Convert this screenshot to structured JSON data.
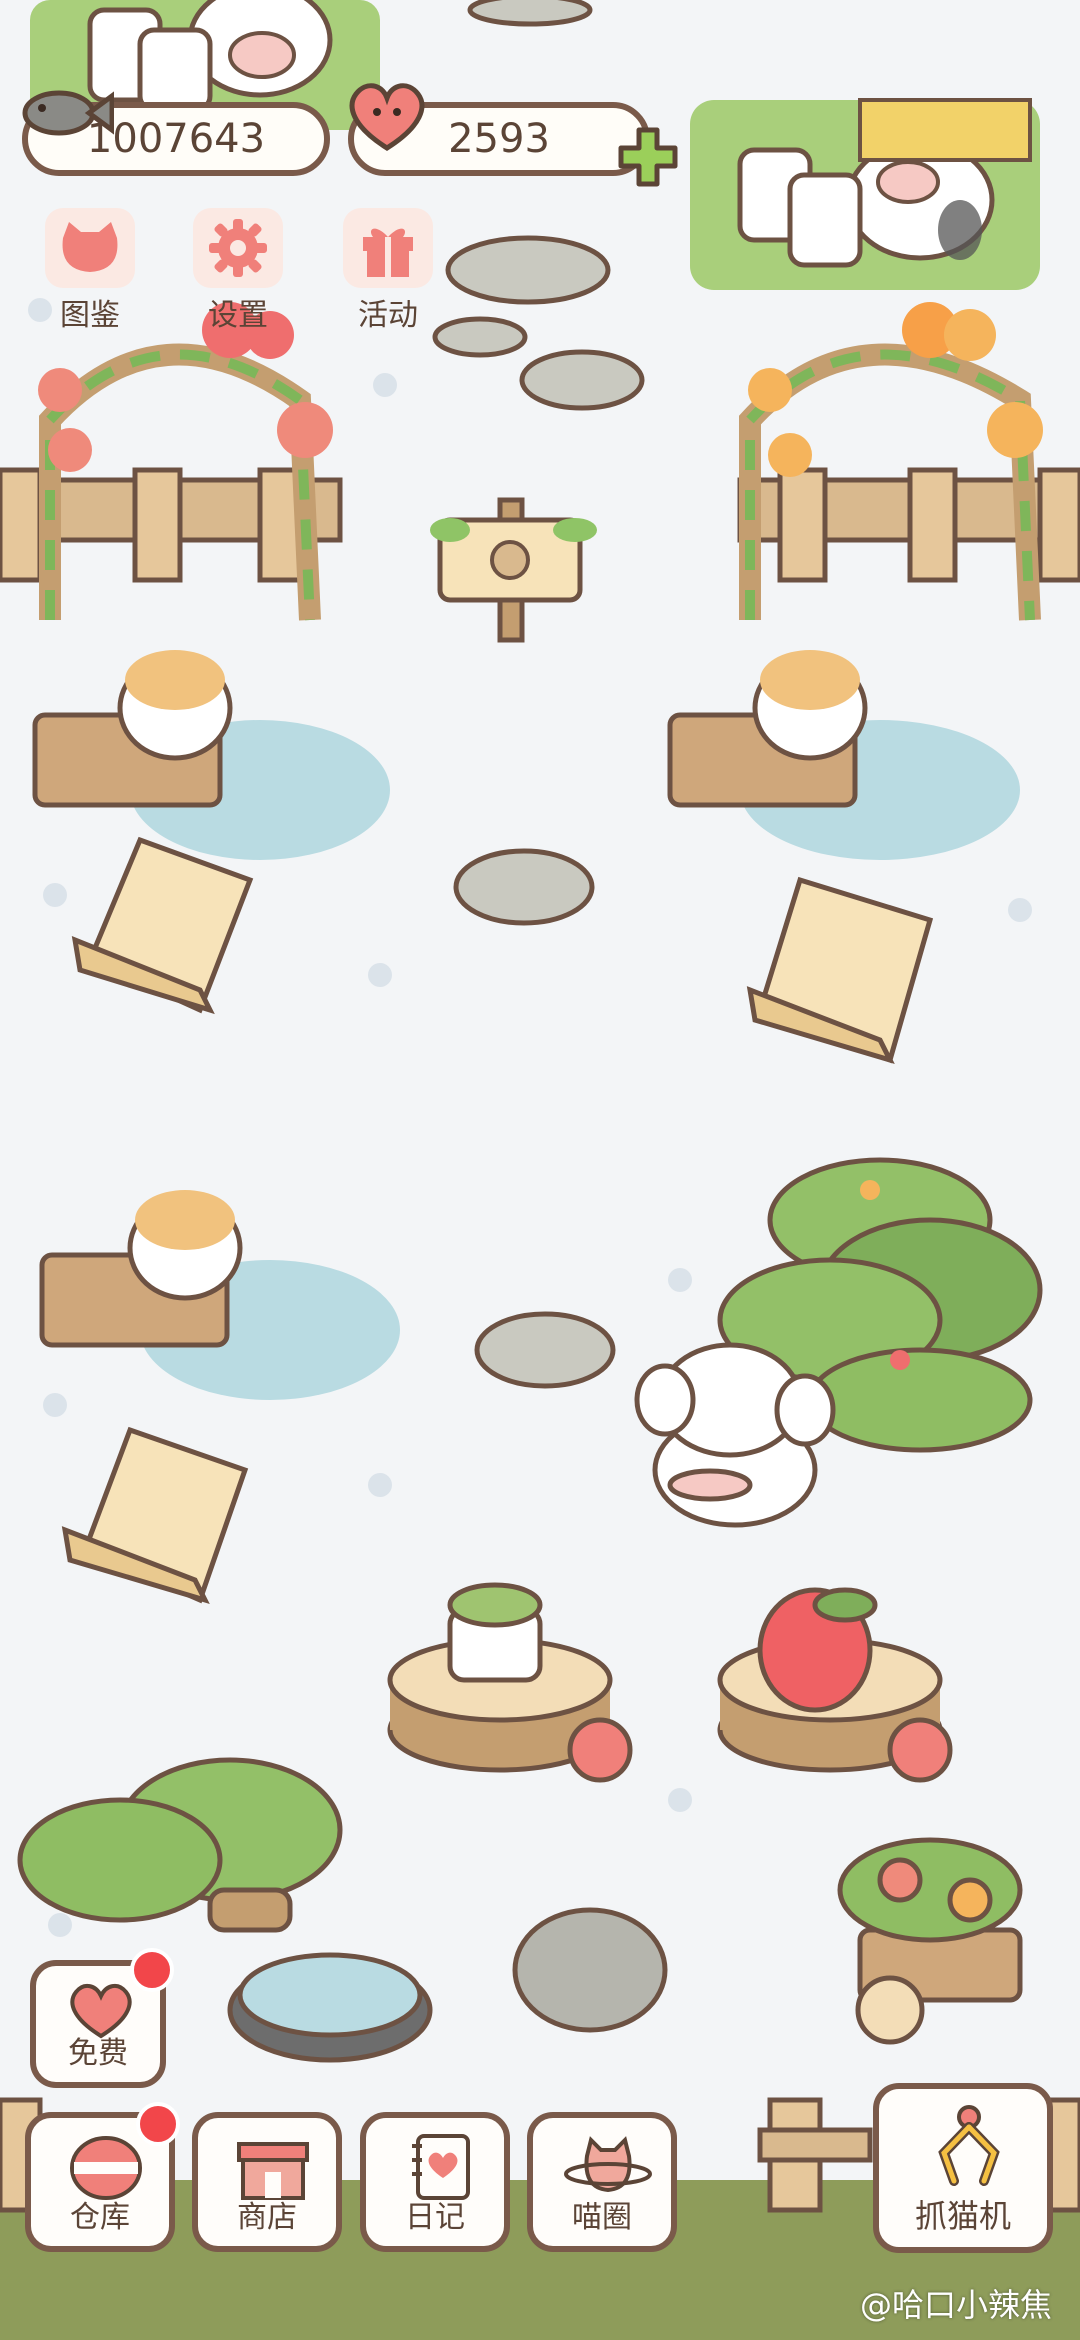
{
  "currency": {
    "fish_value": "1007643",
    "hearts_value": "2593"
  },
  "top_menu": [
    {
      "label": "图鉴",
      "icon": "cat-face-icon"
    },
    {
      "label": "设置",
      "icon": "gear-icon"
    },
    {
      "label": "活动",
      "icon": "gift-icon"
    }
  ],
  "free_button": {
    "label": "免费",
    "icon": "heart-icon"
  },
  "bottom_bar": [
    {
      "label": "仓库",
      "icon": "storage-icon"
    },
    {
      "label": "商店",
      "icon": "shop-icon"
    },
    {
      "label": "日记",
      "icon": "diary-icon"
    },
    {
      "label": "喵圈",
      "icon": "planet-cat-icon"
    }
  ],
  "claw_button": {
    "label": "抓猫机",
    "icon": "claw-icon"
  },
  "watermark": "@哈口小辣焦",
  "colors": {
    "background": "#f3f5f7",
    "outline": "#7a5a4a",
    "badge_red": "#f2464a",
    "grass": "#8a9a55",
    "heart_pink": "#f0807a",
    "plus_green": "#9bcf5a"
  }
}
